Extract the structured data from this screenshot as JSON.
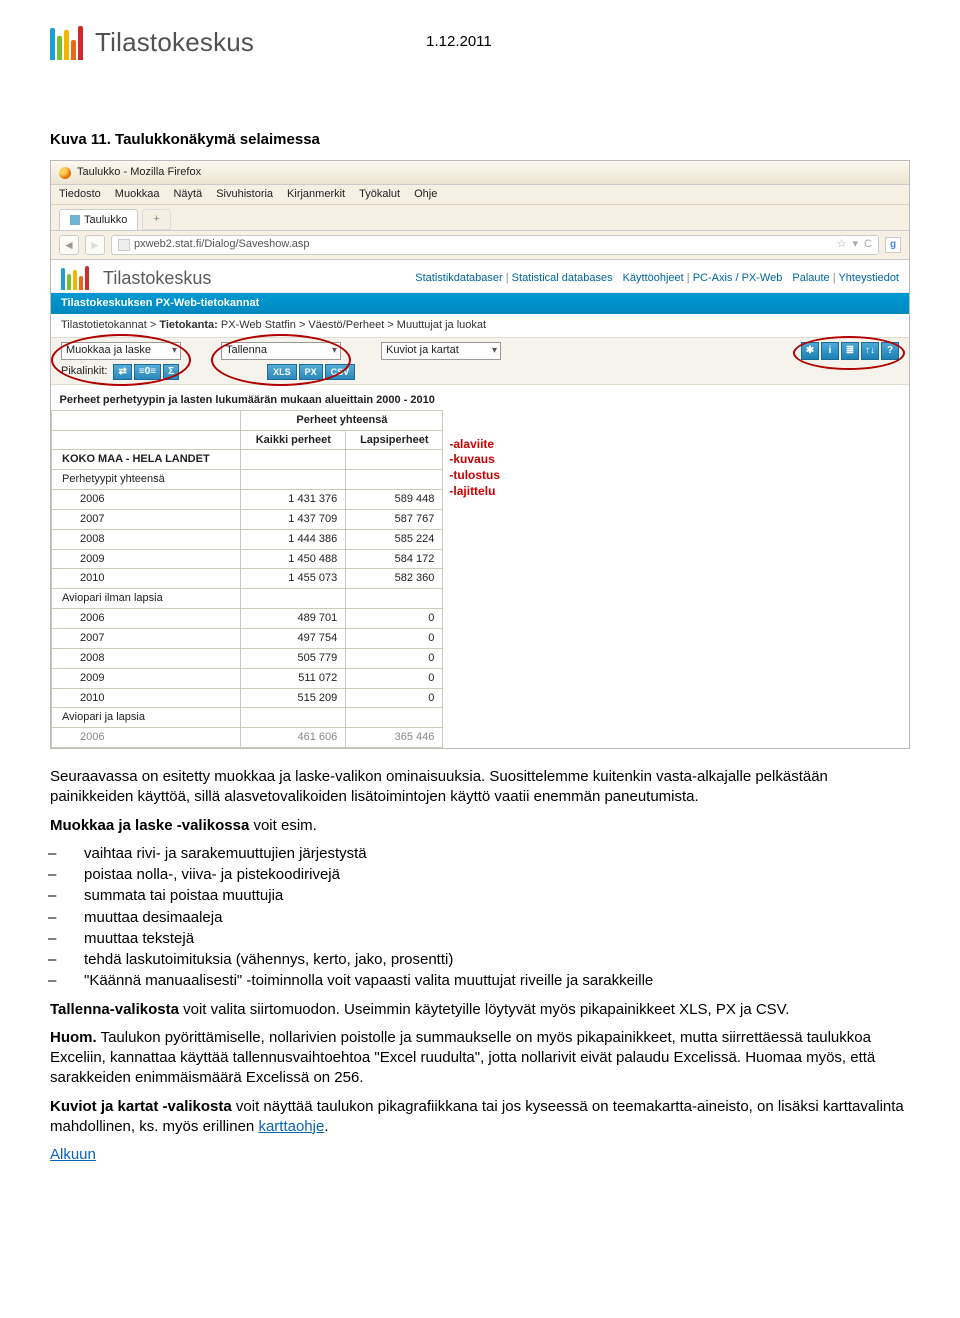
{
  "header": {
    "brand": "Tilastokeskus",
    "date": "1.12.2011"
  },
  "figure_caption": "Kuva 11. Taulukkonäkymä selaimessa",
  "screenshot": {
    "window_title": "Taulukko - Mozilla Firefox",
    "menus": [
      "Tiedosto",
      "Muokkaa",
      "Näytä",
      "Sivuhistoria",
      "Kirjanmerkit",
      "Työkalut",
      "Ohje"
    ],
    "tab_label": "Taulukko",
    "url": "pxweb2.stat.fi/Dialog/Saveshow.asp",
    "site_brand": "Tilastokeskus",
    "toplinks": {
      "g1a": "Statistikdatabaser",
      "g1b": "Statistical databases",
      "g2a": "Käyttöohjeet",
      "g2b": "PC-Axis / PX-Web",
      "g3a": "Palaute",
      "g3b": "Yhteystiedot"
    },
    "bluebar": "Tilastokeskuksen PX-Web-tietokannat",
    "breadcrumb_pre": "Tilastotietokannat > ",
    "breadcrumb_bold": "Tietokanta:",
    "breadcrumb_post": " PX-Web Statfin > Väestö/Perheet > Muuttujat ja luokat",
    "tool_muokkaa": "Muokkaa ja laske",
    "tool_tallenna": "Tallenna",
    "tool_kuviot": "Kuviot ja kartat",
    "pika_label": "Pikalinkit:",
    "chips": [
      "XLS",
      "PX",
      "CSV"
    ],
    "icon_btns": [
      "✱",
      "i",
      "≣",
      "↑↓",
      "?"
    ],
    "table_title": "Perheet perhetyypin ja lasten lukumäärän mukaan alueittain 2000 - 2010",
    "th_grp": "Perheet yhteensä",
    "th1": "Kaikki perheet",
    "th2": "Lapsiperheet",
    "koko_label": "KOKO MAA - HELA LANDET",
    "group1": "Perhetyypit yhteensä",
    "group2": "Aviopari ilman lapsia",
    "group3": "Aviopari ja lapsia",
    "rows1": [
      {
        "y": "2006",
        "a": "1 431 376",
        "b": "589 448"
      },
      {
        "y": "2007",
        "a": "1 437 709",
        "b": "587 767"
      },
      {
        "y": "2008",
        "a": "1 444 386",
        "b": "585 224"
      },
      {
        "y": "2009",
        "a": "1 450 488",
        "b": "584 172"
      },
      {
        "y": "2010",
        "a": "1 455 073",
        "b": "582 360"
      }
    ],
    "rows2": [
      {
        "y": "2006",
        "a": "489 701",
        "b": "0"
      },
      {
        "y": "2007",
        "a": "497 754",
        "b": "0"
      },
      {
        "y": "2008",
        "a": "505 779",
        "b": "0"
      },
      {
        "y": "2009",
        "a": "511 072",
        "b": "0"
      },
      {
        "y": "2010",
        "a": "515 209",
        "b": "0"
      }
    ],
    "cut_row": {
      "y": "2006",
      "a": "461 606",
      "b": "365 446"
    },
    "annot1": "-alaviite",
    "annot2": "-kuvaus",
    "annot3": "-tulostus",
    "annot4": "-lajittelu"
  },
  "body": {
    "p1": "Seuraavassa on esitetty muokkaa ja laske-valikon ominaisuuksia. Suosittelemme kuitenkin vasta-alkajalle pelkästään painikkeiden käyttöä, sillä alasvetovalikoiden lisätoimintojen käyttö vaatii enemmän paneutumista.",
    "p2_bold": "Muokkaa ja laske -valikossa",
    "p2_rest": " voit esim.",
    "bullets": [
      "vaihtaa rivi- ja sarakemuuttujien järjestystä",
      "poistaa nolla-, viiva- ja pistekoodirivejä",
      "summata tai poistaa muuttujia",
      "muuttaa desimaaleja",
      "muuttaa tekstejä",
      "tehdä laskutoimituksia (vähennys, kerto, jako, prosentti)",
      "\"Käännä manuaalisesti\" -toiminnolla voit vapaasti valita muuttujat riveille ja sarakkeille"
    ],
    "p3_bold": "Tallenna-valikosta",
    "p3_rest": " voit valita siirtomuodon. Useimmin käytetyille löytyvät myös pikapainikkeet XLS, PX ja CSV.",
    "p4_bold": "Huom.",
    "p4_rest": " Taulukon pyörittämiselle, nollarivien poistolle ja summaukselle on myös pikapainikkeet, mutta siirrettäessä taulukkoa Exceliin, kannattaa käyttää tallennusvaihtoehtoa \"Excel ruudulta\", jotta nollarivit eivät palaudu Excelissä. Huomaa myös, että sarakkeiden enimmäismäärä Excelissä on 256.",
    "p5_bold": "Kuviot ja kartat -valikosta",
    "p5_rest": " voit näyttää taulukon pikagrafiikkana tai jos kyseessä on teemakartta-aineisto, on lisäksi karttavalinta mahdollinen, ks. myös erillinen ",
    "p5_link": "karttaohje",
    "p5_dot": ".",
    "alkuun": "Alkuun"
  }
}
